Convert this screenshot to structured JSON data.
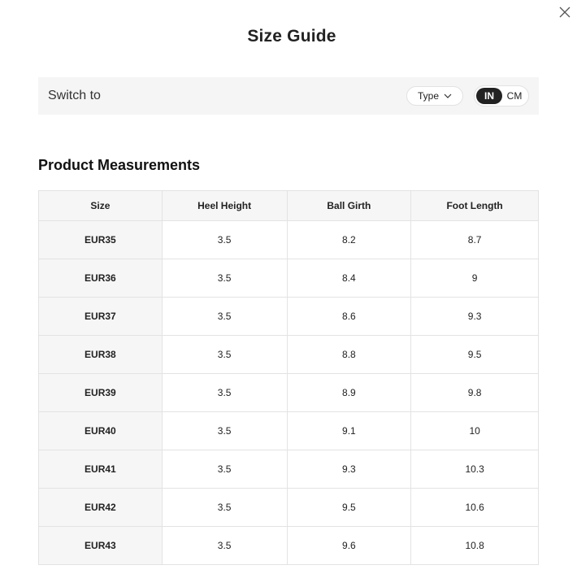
{
  "modal": {
    "title": "Size Guide",
    "close_icon": "close-icon"
  },
  "switch_bar": {
    "label": "Switch to",
    "type_select": {
      "label": "Type",
      "icon": "chevron-down-icon"
    },
    "unit_toggle": {
      "options": [
        "IN",
        "CM"
      ],
      "selected": "IN"
    }
  },
  "measurements": {
    "title": "Product Measurements",
    "columns": [
      "Size",
      "Heel Height",
      "Ball Girth",
      "Foot Length"
    ],
    "rows": [
      [
        "EUR35",
        "3.5",
        "8.2",
        "8.7"
      ],
      [
        "EUR36",
        "3.5",
        "8.4",
        "9"
      ],
      [
        "EUR37",
        "3.5",
        "8.6",
        "9.3"
      ],
      [
        "EUR38",
        "3.5",
        "8.8",
        "9.5"
      ],
      [
        "EUR39",
        "3.5",
        "8.9",
        "9.8"
      ],
      [
        "EUR40",
        "3.5",
        "9.1",
        "10"
      ],
      [
        "EUR41",
        "3.5",
        "9.3",
        "10.3"
      ],
      [
        "EUR42",
        "3.5",
        "9.5",
        "10.6"
      ],
      [
        "EUR43",
        "3.5",
        "9.6",
        "10.8"
      ]
    ]
  }
}
